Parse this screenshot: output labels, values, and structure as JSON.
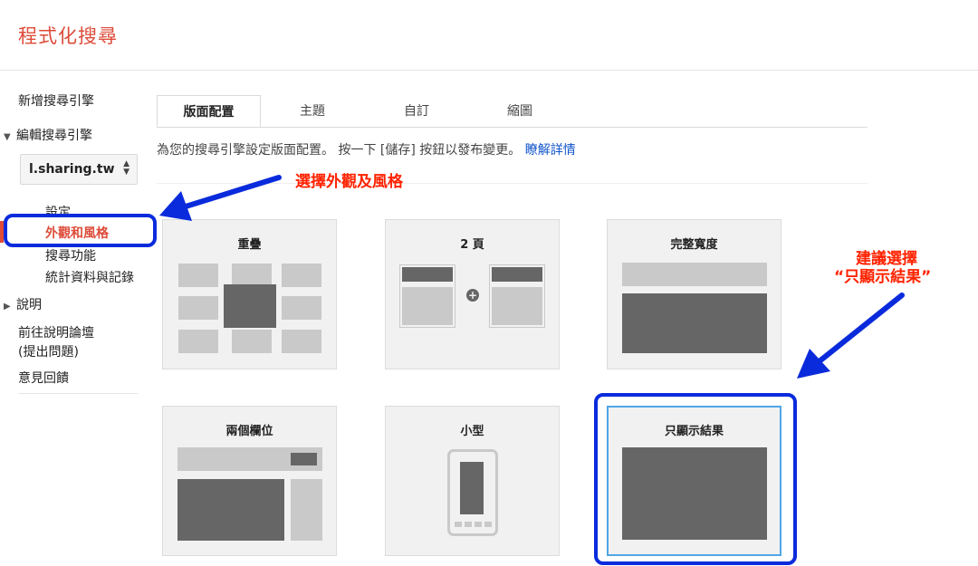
{
  "app": {
    "title": "程式化搜尋"
  },
  "sidebar": {
    "new_engine": "新增搜尋引擎",
    "edit_engine": "編輯搜尋引擎",
    "engine_select": {
      "value": "l.sharing.tw"
    },
    "sub_items": [
      {
        "label": "設定"
      },
      {
        "label": "外觀和風格"
      },
      {
        "label": "搜尋功能"
      },
      {
        "label": "統計資料與記錄"
      }
    ],
    "help": "說明",
    "forum_line1": "前往說明論壇",
    "forum_line2": "(提出問題)",
    "feedback": "意見回饋"
  },
  "tabs": [
    {
      "label": "版面配置",
      "active": true
    },
    {
      "label": "主題"
    },
    {
      "label": "自訂"
    },
    {
      "label": "縮圖"
    }
  ],
  "description": {
    "text": "為您的搜尋引擎設定版面配置。 按一下 [儲存] 按鈕以發布變更。",
    "link": "瞭解詳情"
  },
  "layouts": [
    {
      "label": "重疊"
    },
    {
      "label": "2 頁"
    },
    {
      "label": "完整寬度"
    },
    {
      "label": "兩個欄位"
    },
    {
      "label": "小型"
    },
    {
      "label": "只顯示結果",
      "selected": true
    }
  ],
  "annotations": {
    "callout_1": "選擇外觀及風格",
    "callout_2_line1": "建議選擇",
    "callout_2_line2": "“只顯示結果”"
  },
  "colors": {
    "brand_red": "#dd4b39",
    "link_blue": "#1155cc",
    "annotation_blue": "#0a2bdc",
    "annotation_red": "#ff2200",
    "selected_border": "#4fa6e6"
  }
}
